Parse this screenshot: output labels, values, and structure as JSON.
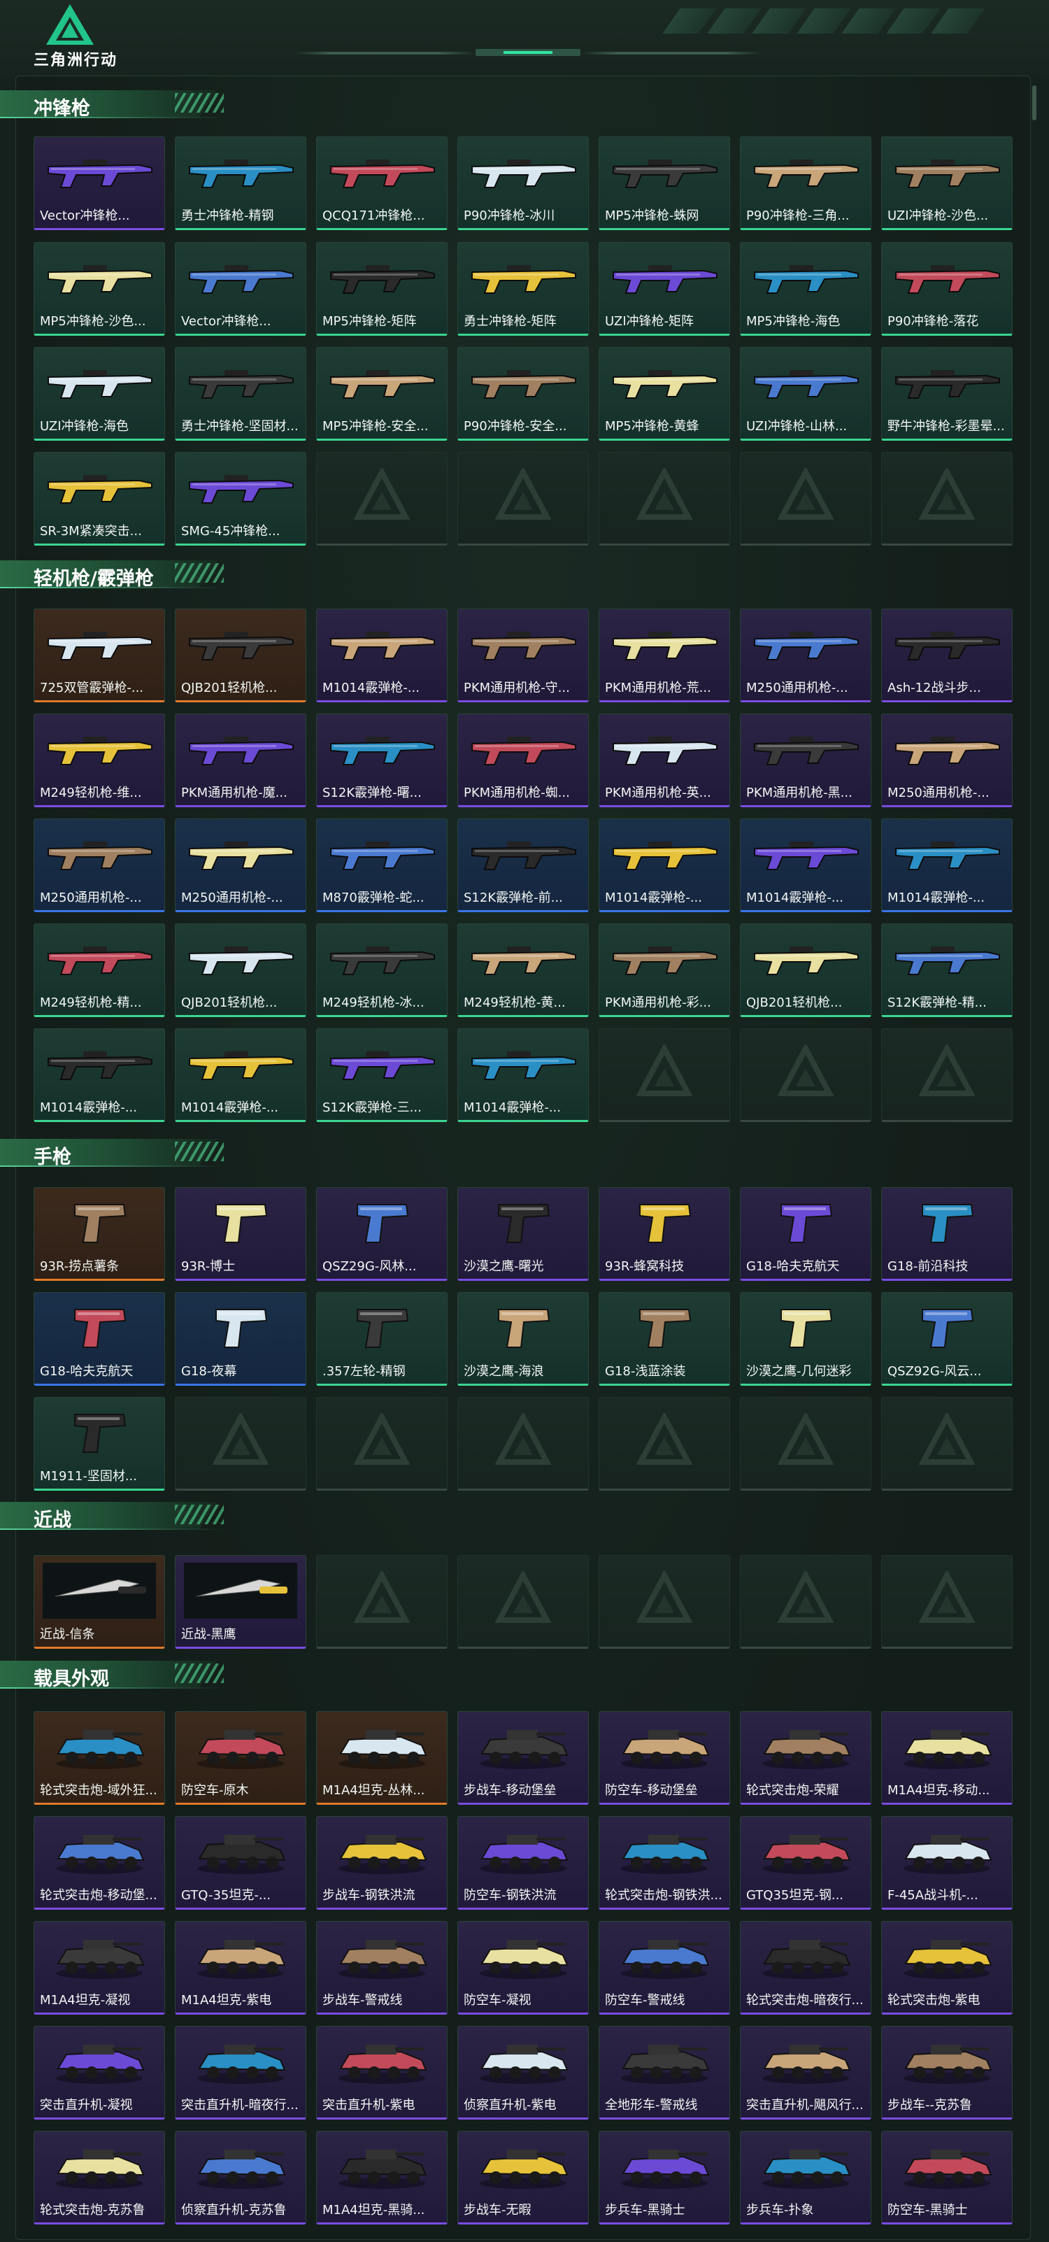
{
  "app": {
    "logo_text": "三角洲行动"
  },
  "sections": [
    {
      "title": "冲锋枪",
      "items": [
        {
          "label": "Vector冲锋枪...",
          "quality": "purple"
        },
        {
          "label": "勇士冲锋枪-精钢",
          "quality": "green"
        },
        {
          "label": "QCQ171冲锋枪...",
          "quality": "green"
        },
        {
          "label": "P90冲锋枪-冰川",
          "quality": "green"
        },
        {
          "label": "MP5冲锋枪-蛛网",
          "quality": "green"
        },
        {
          "label": "P90冲锋枪-三角...",
          "quality": "green"
        },
        {
          "label": "UZI冲锋枪-沙色...",
          "quality": "green"
        },
        {
          "label": "MP5冲锋枪-沙色...",
          "quality": "green"
        },
        {
          "label": "Vector冲锋枪...",
          "quality": "green"
        },
        {
          "label": "MP5冲锋枪-矩阵",
          "quality": "green"
        },
        {
          "label": "勇士冲锋枪-矩阵",
          "quality": "green"
        },
        {
          "label": "UZI冲锋枪-矩阵",
          "quality": "green"
        },
        {
          "label": "MP5冲锋枪-海色",
          "quality": "green"
        },
        {
          "label": "P90冲锋枪-落花",
          "quality": "green"
        },
        {
          "label": "UZI冲锋枪-海色",
          "quality": "green"
        },
        {
          "label": "勇士冲锋枪-坚固材...",
          "quality": "green"
        },
        {
          "label": "MP5冲锋枪-安全...",
          "quality": "green"
        },
        {
          "label": "P90冲锋枪-安全...",
          "quality": "green"
        },
        {
          "label": "MP5冲锋枪-黄蜂",
          "quality": "green"
        },
        {
          "label": "UZI冲锋枪-山林...",
          "quality": "green"
        },
        {
          "label": "野牛冲锋枪-彩墨晕...",
          "quality": "green"
        },
        {
          "label": "SR-3M紧凑突击...",
          "quality": "green"
        },
        {
          "label": "SMG-45冲锋枪...",
          "quality": "green"
        }
      ]
    },
    {
      "title": "轻机枪/霰弹枪",
      "items": [
        {
          "label": "725双管霰弹枪-...",
          "quality": "orange"
        },
        {
          "label": "QJB201轻机枪...",
          "quality": "orange"
        },
        {
          "label": "M1014霰弹枪-...",
          "quality": "purple"
        },
        {
          "label": "PKM通用机枪-守...",
          "quality": "purple"
        },
        {
          "label": "PKM通用机枪-荒...",
          "quality": "purple"
        },
        {
          "label": "M250通用机枪-...",
          "quality": "purple"
        },
        {
          "label": "Ash-12战斗步...",
          "quality": "purple"
        },
        {
          "label": "M249轻机枪-维...",
          "quality": "purple"
        },
        {
          "label": "PKM通用机枪-魔...",
          "quality": "purple"
        },
        {
          "label": "S12K霰弹枪-曙...",
          "quality": "purple"
        },
        {
          "label": "PKM通用机枪-蜘...",
          "quality": "purple"
        },
        {
          "label": "PKM通用机枪-英...",
          "quality": "purple"
        },
        {
          "label": "PKM通用机枪-黑...",
          "quality": "purple"
        },
        {
          "label": "M250通用机枪-...",
          "quality": "purple"
        },
        {
          "label": "M250通用机枪-...",
          "quality": "blue"
        },
        {
          "label": "M250通用机枪-...",
          "quality": "blue"
        },
        {
          "label": "M870霰弹枪-蛇...",
          "quality": "blue"
        },
        {
          "label": "S12K霰弹枪-前...",
          "quality": "blue"
        },
        {
          "label": "M1014霰弹枪-...",
          "quality": "blue"
        },
        {
          "label": "M1014霰弹枪-...",
          "quality": "blue"
        },
        {
          "label": "M1014霰弹枪-...",
          "quality": "blue"
        },
        {
          "label": "M249轻机枪-精...",
          "quality": "green"
        },
        {
          "label": "QJB201轻机枪...",
          "quality": "green"
        },
        {
          "label": "M249轻机枪-冰...",
          "quality": "green"
        },
        {
          "label": "M249轻机枪-黄...",
          "quality": "green"
        },
        {
          "label": "PKM通用机枪-彩...",
          "quality": "green"
        },
        {
          "label": "QJB201轻机枪...",
          "quality": "green"
        },
        {
          "label": "S12K霰弹枪-精...",
          "quality": "green"
        },
        {
          "label": "M1014霰弹枪-...",
          "quality": "green"
        },
        {
          "label": "M1014霰弹枪-...",
          "quality": "green"
        },
        {
          "label": "S12K霰弹枪-三...",
          "quality": "green"
        },
        {
          "label": "M1014霰弹枪-...",
          "quality": "green"
        }
      ]
    },
    {
      "title": "手枪",
      "items": [
        {
          "label": "93R-捞点薯条",
          "quality": "orange"
        },
        {
          "label": "93R-博士",
          "quality": "purple"
        },
        {
          "label": "QSZ29G-风林...",
          "quality": "purple"
        },
        {
          "label": "沙漠之鹰-曙光",
          "quality": "purple"
        },
        {
          "label": "93R-蜂窝科技",
          "quality": "purple"
        },
        {
          "label": "G18-哈夫克航天",
          "quality": "purple"
        },
        {
          "label": "G18-前沿科技",
          "quality": "purple"
        },
        {
          "label": "G18-哈夫克航天",
          "quality": "blue"
        },
        {
          "label": "G18-夜幕",
          "quality": "blue"
        },
        {
          "label": ".357左轮-精钢",
          "quality": "green"
        },
        {
          "label": "沙漠之鹰-海浪",
          "quality": "green"
        },
        {
          "label": "G18-浅蓝涂装",
          "quality": "green"
        },
        {
          "label": "沙漠之鹰-几何迷彩",
          "quality": "green"
        },
        {
          "label": "QSZ92G-风云...",
          "quality": "green"
        },
        {
          "label": "M1911-坚固材...",
          "quality": "green"
        }
      ]
    },
    {
      "title": "近战",
      "items": [
        {
          "label": "近战-信条",
          "quality": "orange"
        },
        {
          "label": "近战-黑鹰",
          "quality": "purple"
        }
      ]
    },
    {
      "title": "载具外观",
      "items": [
        {
          "label": "轮式突击炮-域外狂...",
          "quality": "orange"
        },
        {
          "label": "防空车-原木",
          "quality": "orange"
        },
        {
          "label": "M1A4坦克-丛林...",
          "quality": "orange"
        },
        {
          "label": "步战车-移动堡垒",
          "quality": "purple"
        },
        {
          "label": "防空车-移动堡垒",
          "quality": "purple"
        },
        {
          "label": "轮式突击炮-荣耀",
          "quality": "purple"
        },
        {
          "label": "M1A4坦克-移动...",
          "quality": "purple"
        },
        {
          "label": "轮式突击炮-移动堡...",
          "quality": "purple"
        },
        {
          "label": "GTQ-35坦克-...",
          "quality": "purple"
        },
        {
          "label": "步战车-钢铁洪流",
          "quality": "purple"
        },
        {
          "label": "防空车-钢铁洪流",
          "quality": "purple"
        },
        {
          "label": "轮式突击炮-钢铁洪...",
          "quality": "purple"
        },
        {
          "label": "GTQ35坦克-钢...",
          "quality": "purple"
        },
        {
          "label": "F-45A战斗机-...",
          "quality": "purple"
        },
        {
          "label": "M1A4坦克-凝视",
          "quality": "purple"
        },
        {
          "label": "M1A4坦克-紫电",
          "quality": "purple"
        },
        {
          "label": "步战车-警戒线",
          "quality": "purple"
        },
        {
          "label": "防空车-凝视",
          "quality": "purple"
        },
        {
          "label": "防空车-警戒线",
          "quality": "purple"
        },
        {
          "label": "轮式突击炮-暗夜行...",
          "quality": "purple"
        },
        {
          "label": "轮式突击炮-紫电",
          "quality": "purple"
        },
        {
          "label": "突击直升机-凝视",
          "quality": "purple"
        },
        {
          "label": "突击直升机-暗夜行...",
          "quality": "purple"
        },
        {
          "label": "突击直升机-紫电",
          "quality": "purple"
        },
        {
          "label": "侦察直升机-紫电",
          "quality": "purple"
        },
        {
          "label": "全地形车-警戒线",
          "quality": "purple"
        },
        {
          "label": "突击直升机-飓风行...",
          "quality": "purple"
        },
        {
          "label": "步战车--克苏鲁",
          "quality": "purple"
        },
        {
          "label": "轮式突击炮-克苏鲁",
          "quality": "purple"
        },
        {
          "label": "侦察直升机-克苏鲁",
          "quality": "purple"
        },
        {
          "label": "M1A4坦克-黑骑...",
          "quality": "purple"
        },
        {
          "label": "步战车-无暇",
          "quality": "purple"
        },
        {
          "label": "步兵车-黑骑士",
          "quality": "purple"
        },
        {
          "label": "步兵车-扑象",
          "quality": "purple"
        },
        {
          "label": "防空车-黑骑士",
          "quality": "purple"
        }
      ]
    }
  ]
}
